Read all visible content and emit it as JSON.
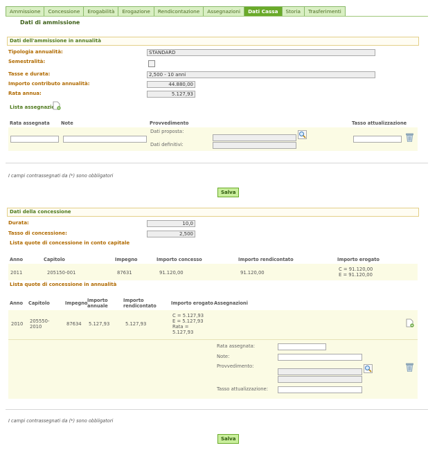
{
  "tabs": [
    "Ammissione",
    "Concessione",
    "Erogabilità",
    "Erogazione",
    "Rendicontazione",
    "Assegnazioni",
    "Dati Cassa",
    "Storia",
    "Trasferimenti"
  ],
  "active_tab": "Dati Cassa",
  "page_title": "Dati di ammissione",
  "admission": {
    "section_title": "Dati dell'ammissione in annualità",
    "tipologia_label": "Tipologia annualità:",
    "tipologia_value": "STANDARD",
    "semestralita_label": "Semestralità:",
    "tasso_label": "Tasse e durata:",
    "tasso_value": "2,500 - 10 anni",
    "importo_label": "Importo contributo annualità:",
    "importo_value": "44.880,00",
    "rata_label": "Rata annua:",
    "rata_value": "5.127,93",
    "lista_label": "Lista assegnazioni",
    "columns": [
      "Rata assegnata",
      "Note",
      "Provvedimento",
      "Tasso attualizzazione"
    ],
    "dati_proposta": "Dati proposta:",
    "dati_definitivi": "Dati definitivi:"
  },
  "required_note": "I campi contrassegnati da (*) sono obbligatori",
  "save_label": "Salva",
  "concession": {
    "section_title": "Dati della concessione",
    "durata_label": "Durata:",
    "durata_value": "10,0",
    "tasso_label": "Tasso di concessione:",
    "tasso_value": "2,500",
    "capitale_title": "Lista quote di concessione in conto capitale",
    "capitale_columns": [
      "Anno",
      "Capitolo",
      "Impegno",
      "Importo concesso",
      "Importo rendicontato",
      "Importo erogato"
    ],
    "capitale_row": {
      "anno": "2011",
      "capitolo": "205150-001",
      "impegno": "87631",
      "concesso": "91.120,00",
      "rendicontato": "91.120,00",
      "erogato_c": "C = 91.120,00",
      "erogato_e": "E = 91.120,00"
    },
    "annualita_title": "Lista quote di concessione in annualità",
    "annualita_columns": {
      "anno": "Anno",
      "capitolo": "Capitolo",
      "impegno": "Impegno",
      "annuale_1": "Importo",
      "annuale_2": "annuale",
      "rend_1": "Importo",
      "rend_2": "rendicontato",
      "erogato": "Importo erogato",
      "assegnazioni": "Assegnazioni"
    },
    "annualita_row": {
      "anno": "2010",
      "capitolo_1": "205550-",
      "capitolo_2": "2010",
      "impegno": "87634",
      "annuale": "5.127,93",
      "rendicontato": "5.127,93",
      "erogato_c": "C = 5.127,93",
      "erogato_e": "E = 5.127,93",
      "erogato_r1": "Rata =",
      "erogato_r2": "5.127,93"
    },
    "form": {
      "rata_label": "Rata assegnata:",
      "note_label": "Note:",
      "provvedimento_label": "Provvedimento:",
      "tasso_label": "Tasso attualizzazione:"
    }
  }
}
